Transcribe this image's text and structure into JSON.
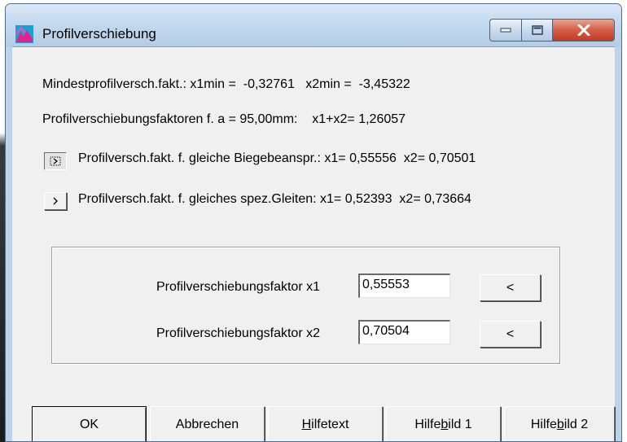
{
  "window": {
    "title": "Profilverschiebung"
  },
  "info": {
    "line1": "Mindestprofilversch.fakt.: x1min =  -0,32761   x2min =  -3,45322",
    "line2": "Profilverschiebungsfaktoren f. a = 95,00mm:    x1+x2= 1,26057"
  },
  "options": [
    {
      "text": "Profilversch.fakt. f. gleiche Biegebeanspr.: x1= 0,55556  x2= 0,70501"
    },
    {
      "text": "Profilversch.fakt. f. gleiches spez.Gleiten: x1= 0,52393  x2= 0,73664"
    }
  ],
  "fields": {
    "x1": {
      "label": "Profilverschiebungsfaktor x1",
      "value": "0,55553",
      "button": "<"
    },
    "x2": {
      "label": "Profilverschiebungsfaktor x2",
      "value": "0,70504",
      "button": "<"
    }
  },
  "buttons": {
    "ok": "OK",
    "cancel": "Abbrechen",
    "helptext": {
      "pre": "",
      "ul": "H",
      "post": "ilfetext"
    },
    "helpimg1": {
      "pre": "Hilfe",
      "ul": "b",
      "post": "ild 1"
    },
    "helpimg2": {
      "pre": "Hilfe",
      "ul": "b",
      "post": "ild 2"
    }
  },
  "colors": {
    "titlebar": "#c3d9ef",
    "close": "#c33b1f",
    "face": "#f0f0f0"
  },
  "icons": {
    "app": "app-icon",
    "minimize": "minimize-icon",
    "maximize": "maximize-icon",
    "close": "close-icon",
    "arrow": "arrow-right-icon"
  }
}
